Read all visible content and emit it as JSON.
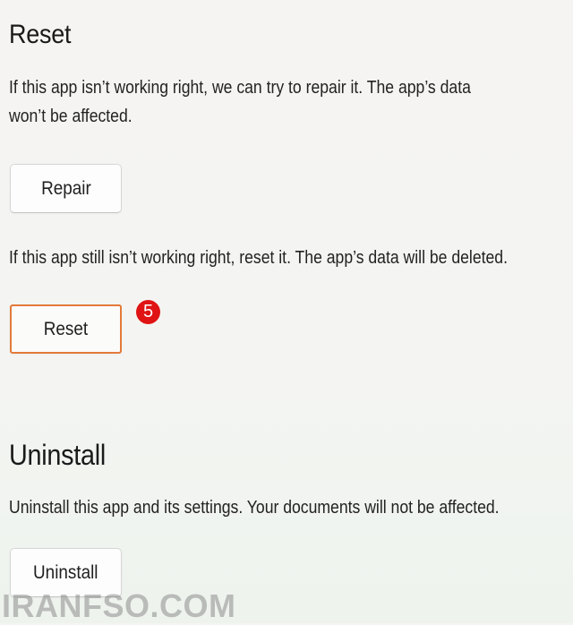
{
  "reset_section": {
    "title": "Reset",
    "repair_description_line1": "If this app isn’t working right, we can try to repair it. The app’s data",
    "repair_description_line2": "won’t be affected.",
    "repair_button": "Repair",
    "reset_description": "If this app still isn’t working right, reset it. The app’s data will be deleted.",
    "reset_button": "Reset",
    "step_badge": "5",
    "badge_color": "#e01414",
    "highlight_color": "#e27a3a"
  },
  "uninstall_section": {
    "title": "Uninstall",
    "description": "Uninstall this app and its settings. Your documents will not be affected.",
    "uninstall_button": "Uninstall"
  },
  "watermark": "IRANFSO.COM"
}
